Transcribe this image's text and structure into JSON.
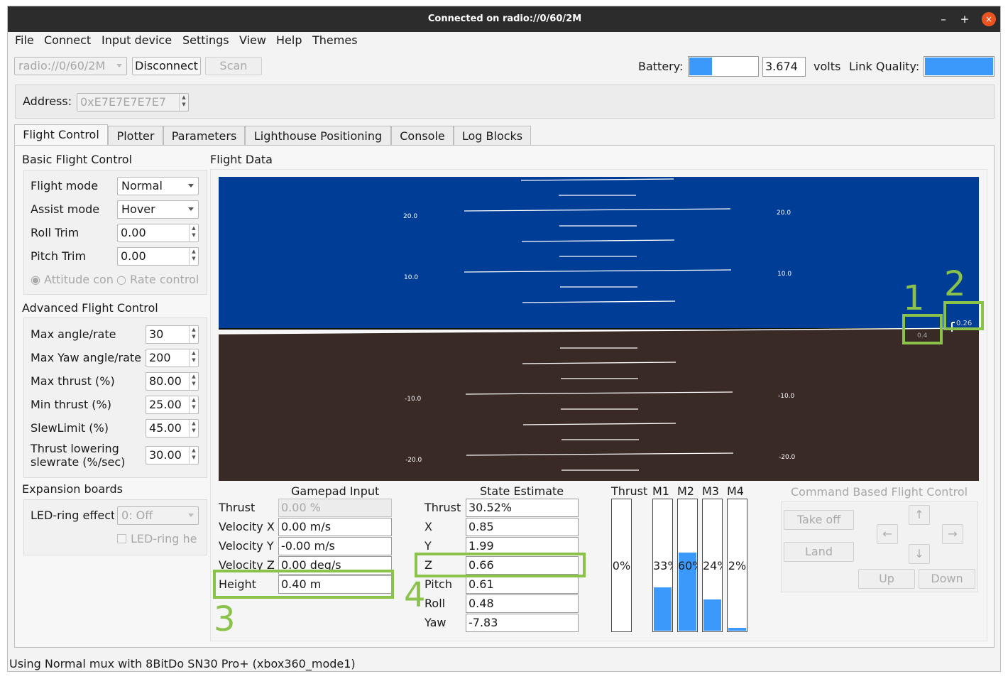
{
  "window": {
    "title": "Connected on radio://0/60/2M"
  },
  "titlebar_buttons": {
    "minimize": "–",
    "maximize": "+",
    "close": "×"
  },
  "menu": [
    "File",
    "Connect",
    "Input device",
    "Settings",
    "View",
    "Help",
    "Themes"
  ],
  "connection": {
    "uri_value": "radio://0/60/2M",
    "disconnect_label": "Disconnect",
    "scan_label": "Scan",
    "battery_label": "Battery:",
    "battery_level": 0.33,
    "voltage": "3.674",
    "volts_label": "volts",
    "link_quality_label": "Link Quality:",
    "link_quality_level": 1.0,
    "address_label": "Address:",
    "address_value": "0xE7E7E7E7E7"
  },
  "tabs": [
    "Flight Control",
    "Plotter",
    "Parameters",
    "Lighthouse Positioning",
    "Console",
    "Log Blocks"
  ],
  "basic_flight_control": {
    "title": "Basic Flight Control",
    "flight_mode_label": "Flight mode",
    "flight_mode_value": "Normal",
    "assist_mode_label": "Assist mode",
    "assist_mode_value": "Hover",
    "roll_trim_label": "Roll Trim",
    "roll_trim_value": "0.00",
    "pitch_trim_label": "Pitch Trim",
    "pitch_trim_value": "0.00",
    "attitude_radio": "Attitude con",
    "rate_radio": "Rate control"
  },
  "advanced_flight_control": {
    "title": "Advanced Flight Control",
    "rows": [
      {
        "label": "Max angle/rate",
        "value": "30"
      },
      {
        "label": "Max Yaw angle/rate",
        "value": "200"
      },
      {
        "label": "Max thrust (%)",
        "value": "80.00"
      },
      {
        "label": "Min thrust (%)",
        "value": "25.00"
      },
      {
        "label": "SlewLimit (%)",
        "value": "45.00"
      }
    ],
    "thrust_lowering_label_1": "Thrust lowering",
    "thrust_lowering_label_2": "slewrate (%/sec)",
    "thrust_lowering_value": "30.00"
  },
  "expansion_boards": {
    "title": "Expansion boards",
    "led_ring_effect_label": "LED-ring effect",
    "led_ring_effect_value": "0: Off",
    "led_ring_headlight_label": "LED-ring he"
  },
  "flight_data": {
    "title": "Flight Data",
    "pitch_labels_up": [
      "20.0",
      "10.0"
    ],
    "pitch_labels_down": [
      "-10.0",
      "-20.0"
    ],
    "height_readout": "0.4",
    "target_readout": "0.26"
  },
  "gamepad_input": {
    "title": "Gamepad Input",
    "rows": [
      {
        "label": "Thrust",
        "value": "0.00 %"
      },
      {
        "label": "Velocity X",
        "value": "0.00 m/s"
      },
      {
        "label": "Velocity Y",
        "value": "-0.00 m/s"
      },
      {
        "label": "Velocity Z",
        "value": "0.00 deg/s"
      },
      {
        "label": "Height",
        "value": "0.40 m"
      }
    ]
  },
  "state_estimate": {
    "title": "State Estimate",
    "rows": [
      {
        "label": "Thrust",
        "value": "30.52%"
      },
      {
        "label": "X",
        "value": "0.85"
      },
      {
        "label": "Y",
        "value": "1.99"
      },
      {
        "label": "Z",
        "value": "0.66"
      },
      {
        "label": "Pitch",
        "value": "0.61"
      },
      {
        "label": "Roll",
        "value": "0.48"
      },
      {
        "label": "Yaw",
        "value": "-7.83"
      }
    ]
  },
  "motor_bars": [
    {
      "label": "Thrust",
      "text": "0%",
      "level": 0.0
    },
    {
      "label": "M1",
      "text": "33%",
      "level": 0.33
    },
    {
      "label": "M2",
      "text": "60%",
      "level": 0.6
    },
    {
      "label": "M3",
      "text": "24%",
      "level": 0.24
    },
    {
      "label": "M4",
      "text": "2%",
      "level": 0.02
    }
  ],
  "command_based": {
    "title": "Command Based Flight Control",
    "take_off": "Take off",
    "land": "Land",
    "up": "Up",
    "down": "Down",
    "arrow_up": "↑",
    "arrow_down": "↓",
    "arrow_left": "←",
    "arrow_right": "→"
  },
  "annotations": [
    "1",
    "2",
    "3",
    "4"
  ],
  "status_bar": "Using Normal mux with 8BitDo SN30 Pro+ (xbox360_mode1)",
  "colors": {
    "sky": "#003d96",
    "ground": "#3a2a26",
    "accent": "#3b99fc",
    "highlight": "#8bc34a",
    "titlebar": "#2c2c2c",
    "close": "#e95420"
  }
}
